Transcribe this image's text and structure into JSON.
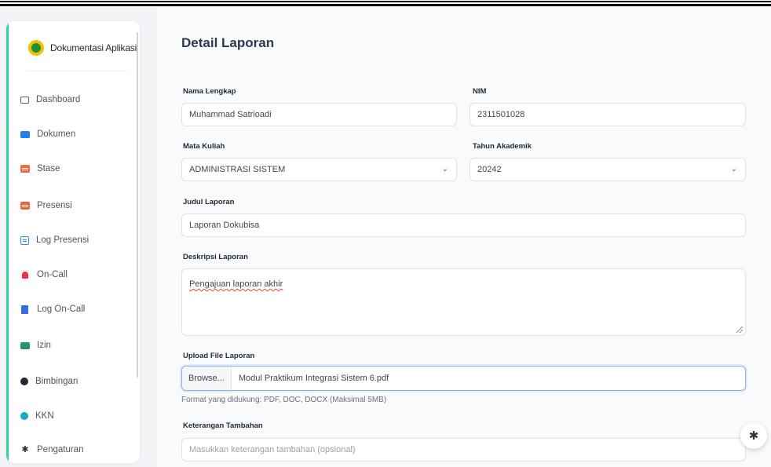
{
  "brand": {
    "name": "Dokumentasi Aplikasi UNISA"
  },
  "sidebar": {
    "items": [
      {
        "label": "Dashboard",
        "icon": "monitor-icon"
      },
      {
        "label": "Dokumen",
        "icon": "folder-icon"
      },
      {
        "label": "Stase",
        "icon": "calendar-icon"
      },
      {
        "label": "Presensi",
        "icon": "calendar-check-icon"
      },
      {
        "label": "Log Presensi",
        "icon": "list-icon"
      },
      {
        "label": "On-Call",
        "icon": "bell-icon"
      },
      {
        "label": "Log On-Call",
        "icon": "book-icon"
      },
      {
        "label": "Izin",
        "icon": "izin-icon"
      },
      {
        "label": "Bimbingan",
        "icon": "chat-icon"
      },
      {
        "label": "KKN",
        "icon": "globe-icon"
      },
      {
        "label": "Pengaturan",
        "icon": "gear-icon"
      }
    ]
  },
  "page": {
    "title": "Detail Laporan"
  },
  "form": {
    "nama": {
      "label": "Nama Lengkap",
      "value": "Muhammad Satrioadi"
    },
    "nim": {
      "label": "NIM",
      "value": "2311501028"
    },
    "mata_kuliah": {
      "label": "Mata Kuliah",
      "value": "ADMINISTRASI SISTEM"
    },
    "tahun": {
      "label": "Tahun Akademik",
      "value": "20242"
    },
    "judul": {
      "label": "Judul Laporan",
      "value": "Laporan Dokubisa"
    },
    "deskripsi": {
      "label": "Deskripsi Laporan",
      "value": "Pengajuan laporan akhir"
    },
    "upload": {
      "label": "Upload File Laporan",
      "browse": "Browse...",
      "filename": "Modul Praktikum Integrasi Sistem 6.pdf",
      "help": "Format yang didukung: PDF, DOC, DOCX (Maksimal 5MB)"
    },
    "keterangan": {
      "label": "Keterangan Tambahan",
      "placeholder": "Masukkan keterangan tambahan (opsional)"
    }
  },
  "colors": {
    "accent": "#2fd3a4",
    "primary": "#3b63c4",
    "focus": "#8fb2e6"
  }
}
